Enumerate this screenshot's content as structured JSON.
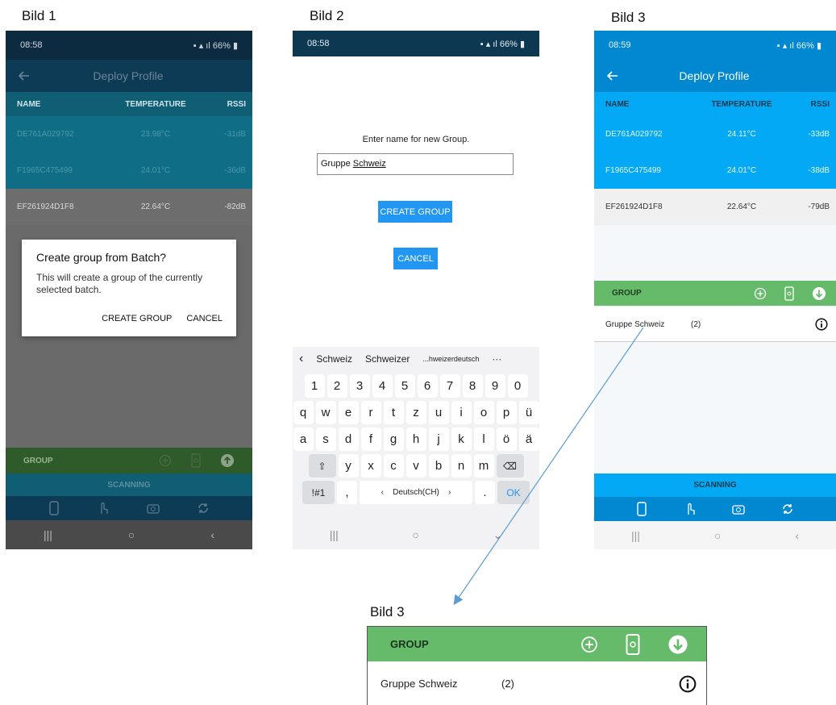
{
  "captions": {
    "bild1": "Bild 1",
    "bild2": "Bild 2",
    "bild3": "Bild 3",
    "bild3_zoom": "Bild 3"
  },
  "screen1": {
    "status": {
      "time": "08:58",
      "right": "66%"
    },
    "title": "Deploy Profile",
    "headers": {
      "name": "NAME",
      "temperature": "TEMPERATURE",
      "rssi": "RSSI"
    },
    "rows": [
      {
        "name": "DE761A029792",
        "temp": "23.98°C",
        "rssi": "-31dB"
      },
      {
        "name": "F1965C475499",
        "temp": "24.01°C",
        "rssi": "-36dB"
      },
      {
        "name": "EF261924D1F8",
        "temp": "22.64°C",
        "rssi": "-82dB"
      }
    ],
    "dialog": {
      "title": "Create group from Batch?",
      "message": "This will create a group of the currently selected batch.",
      "confirm": "CREATE GROUP",
      "cancel": "CANCEL"
    },
    "group_label": "GROUP",
    "scanning_label": "SCANNING"
  },
  "screen2": {
    "status": {
      "time": "08:58",
      "right": "66%"
    },
    "prompt": "Enter name for new Group.",
    "input_value_prefix": "Gruppe ",
    "input_value_word": "Schweiz",
    "create_button": "CREATE GROUP",
    "cancel_button": "CANCEL",
    "keyboard": {
      "suggestions": [
        "Schweiz",
        "Schweizer",
        "...hweizerdeutsch"
      ],
      "row_numbers": [
        "1",
        "2",
        "3",
        "4",
        "5",
        "6",
        "7",
        "8",
        "9",
        "0"
      ],
      "row1": [
        "q",
        "w",
        "e",
        "r",
        "t",
        "z",
        "u",
        "i",
        "o",
        "p",
        "ü"
      ],
      "row2": [
        "a",
        "s",
        "d",
        "f",
        "g",
        "h",
        "j",
        "k",
        "l",
        "ö",
        "ä"
      ],
      "row3": [
        "y",
        "x",
        "c",
        "v",
        "b",
        "n",
        "m"
      ],
      "symbols_key": "!#1",
      "comma_key": ",",
      "language": "Deutsch(CH)",
      "period_key": ".",
      "ok_key": "OK"
    }
  },
  "screen3": {
    "status": {
      "time": "08:59",
      "right": "66%"
    },
    "title": "Deploy Profile",
    "headers": {
      "name": "NAME",
      "temperature": "TEMPERATURE",
      "rssi": "RSSI"
    },
    "rows": [
      {
        "name": "DE761A029792",
        "temp": "24.11°C",
        "rssi": "-33dB"
      },
      {
        "name": "F1965C475499",
        "temp": "24.01°C",
        "rssi": "-38dB"
      },
      {
        "name": "EF261924D1F8",
        "temp": "22.64°C",
        "rssi": "-79dB"
      }
    ],
    "group_label": "GROUP",
    "group_item": {
      "name": "Gruppe Schweiz",
      "count": "(2)"
    },
    "scanning_label": "SCANNING"
  },
  "zoom": {
    "group_label": "GROUP",
    "group_item": {
      "name": "Gruppe Schweiz",
      "count": "(2)"
    }
  },
  "colors": {
    "accent_blue": "#03a9f4",
    "dark_blue": "#0288d1",
    "group_green": "#66bb6a",
    "button_blue": "#2196f3",
    "arrow": "#5b9bd5"
  }
}
